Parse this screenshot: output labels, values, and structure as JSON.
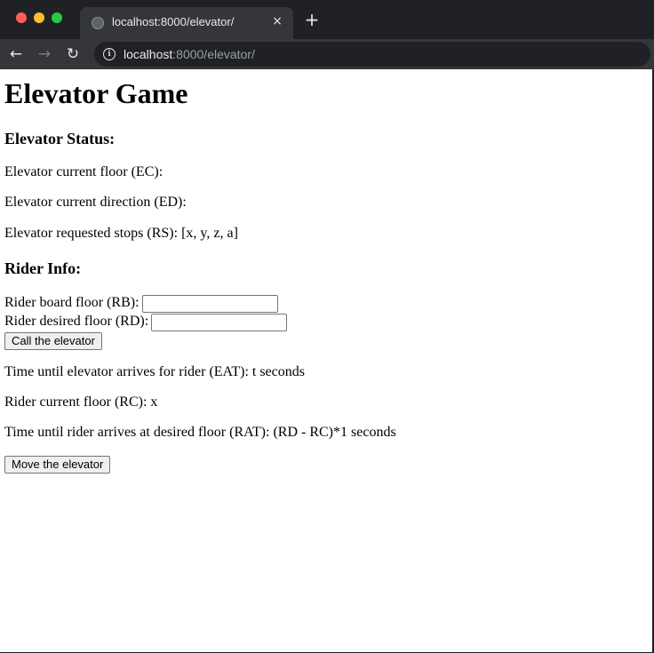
{
  "browser": {
    "tab": {
      "title": "localhost:8000/elevator/",
      "close_symbol": "×"
    },
    "new_tab_symbol": "+",
    "nav": {
      "back_symbol": "←",
      "forward_symbol": "→",
      "reload_symbol": "↻"
    },
    "address": {
      "info_symbol": "i",
      "host": "localhost",
      "path": ":8000/elevator/"
    }
  },
  "page": {
    "title": "Elevator Game",
    "status_heading": "Elevator Status:",
    "status_lines": [
      "Elevator current floor (EC):",
      "Elevator current direction (ED):",
      "Elevator requested stops (RS): [x, y, z, a]"
    ],
    "rider_heading": "Rider Info:",
    "board_floor_label": "Rider board floor (RB):",
    "board_floor_value": "",
    "desired_floor_label": "Rider desired floor (RD):",
    "desired_floor_value": "",
    "call_button": "Call the elevator",
    "result_lines": [
      "Time until elevator arrives for rider (EAT): t seconds",
      "Rider current floor (RC): x",
      "Time until rider arrives at desired floor (RAT): (RD - RC)*1 seconds"
    ],
    "move_button": "Move the elevator"
  },
  "colors": {
    "tabbar": "#202124",
    "toolbar": "#35363a",
    "page_background": "#ffffff",
    "close_light": "#ff5f57",
    "minimize_light": "#febc2e",
    "zoom_light": "#28c840"
  }
}
